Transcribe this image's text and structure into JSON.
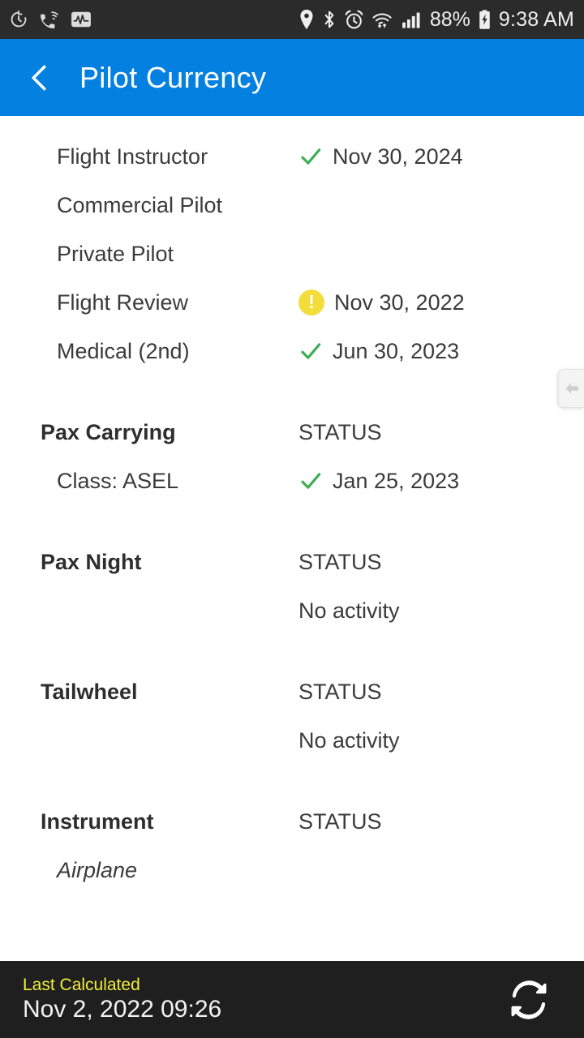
{
  "statusbar": {
    "left_icons": [
      "timer-reset-icon",
      "wifi-calling-icon",
      "activity-monitor-icon"
    ],
    "right_icons": [
      "location-pin-icon",
      "bluetooth-icon",
      "alarm-clock-icon",
      "wifi-icon",
      "cellular-signal-icon"
    ],
    "battery_percent": "88%",
    "battery_icon": "battery-charging-icon",
    "time": "9:38 AM"
  },
  "appbar": {
    "back_icon": "chevron-left-icon",
    "title": "Pilot Currency",
    "background": "#0480e0"
  },
  "colors": {
    "ok": "#3dae56",
    "warn": "#f2dd3a",
    "accent": "#0480e0",
    "highlight": "#f2ee3c"
  },
  "certificates": [
    {
      "label": "Flight Instructor",
      "icon": "check-icon",
      "value": "Nov 30, 2024"
    },
    {
      "label": "Commercial Pilot",
      "icon": "",
      "value": ""
    },
    {
      "label": "Private Pilot",
      "icon": "",
      "value": ""
    },
    {
      "label": "Flight Review",
      "icon": "warning-icon",
      "value": "Nov 30, 2022"
    },
    {
      "label": "Medical (2nd)",
      "icon": "check-icon",
      "value": "Jun 30, 2023"
    }
  ],
  "sections": [
    {
      "title": "Pax Carrying",
      "status_header": "STATUS",
      "rows": [
        {
          "label": "Class: ASEL",
          "icon": "check-icon",
          "value": "Jan 25, 2023",
          "italic": false
        }
      ]
    },
    {
      "title": "Pax Night",
      "status_header": "STATUS",
      "rows": [
        {
          "label": "",
          "icon": "",
          "value": "No activity",
          "italic": false
        }
      ]
    },
    {
      "title": "Tailwheel",
      "status_header": "STATUS",
      "rows": [
        {
          "label": "",
          "icon": "",
          "value": "No activity",
          "italic": false
        }
      ]
    },
    {
      "title": "Instrument",
      "status_header": "STATUS",
      "rows": [
        {
          "label": "Airplane",
          "icon": "",
          "value": "",
          "italic": true
        }
      ]
    }
  ],
  "edge_handle": {
    "icon": "arrow-left-icon"
  },
  "bottombar": {
    "label": "Last Calculated",
    "value": "Nov 2, 2022 09:26",
    "refresh_icon": "refresh-icon"
  }
}
